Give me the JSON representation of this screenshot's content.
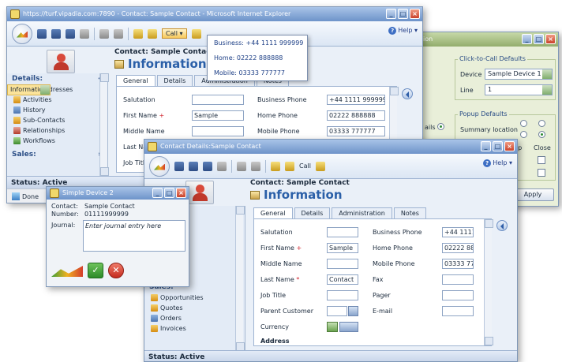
{
  "main_window": {
    "title": "https://turf.vipadia.com:7890 - Contact: Sample Contact - Microsoft Internet Explorer",
    "call_label": "Call",
    "help_label": "Help",
    "header_contact": "Contact: Sample Contact",
    "header_section": "Information",
    "tabs": [
      "General",
      "Details",
      "Administration",
      "Notes"
    ],
    "sidebar_title": "Details:",
    "sidebar_items": [
      "Information",
      "More Addresses",
      "Activities",
      "History",
      "Sub-Contacts",
      "Relationships",
      "Workflows"
    ],
    "sales_title": "Sales:",
    "status": "Status: Active",
    "ie_status": "Done",
    "form": {
      "salutation_label": "Salutation",
      "first_name_label": "First Name",
      "first_name_value": "Sample",
      "middle_name_label": "Middle Name",
      "last_name_label": "Last Na",
      "job_title_label": "Job Title",
      "business_phone_label": "Business Phone",
      "business_phone_value": "+44 1111 999999",
      "home_phone_label": "Home Phone",
      "home_phone_value": "02222 888888",
      "mobile_phone_label": "Mobile Phone",
      "mobile_phone_value": "03333 777777"
    }
  },
  "call_menu": {
    "items": [
      "Business: +44 1111 999999",
      "Home: 02222 888888",
      "Mobile: 03333 777777"
    ]
  },
  "options_window": {
    "title": "ion",
    "click_to_call_title": "Click-to-Call Defaults",
    "device_label": "Device",
    "device_value": "Sample Device 1",
    "line_label": "Line",
    "line_value": "1",
    "popup_title": "Popup Defaults",
    "summary_location_label": "Summary location",
    "partial_left": "ails",
    "popup_label_partial": "up",
    "close_label": "Close",
    "apply_label": "Apply"
  },
  "details_window": {
    "title": "Contact Details:Sample Contact",
    "call_label": "Call",
    "help_label": "Help",
    "header_contact": "Contact: Sample Contact",
    "header_section": "Information",
    "tabs": [
      "General",
      "Details",
      "Administration",
      "Notes"
    ],
    "sidebar_partial": [
      "n",
      "resses",
      "cts",
      "ips"
    ],
    "sales_title": "Sales:",
    "sales_items": [
      "Opportunities",
      "Quotes",
      "Orders",
      "Invoices"
    ],
    "status": "Status: Active",
    "form": {
      "salutation_label": "Salutation",
      "first_name_label": "First Name",
      "first_name_value": "Sample",
      "middle_name_label": "Middle Name",
      "last_name_label": "Last Name",
      "last_name_value": "Contact",
      "job_title_label": "Job Title",
      "parent_customer_label": "Parent Customer",
      "currency_label": "Currency",
      "address_label": "Address",
      "business_phone_label": "Business Phone",
      "business_phone_value": "+44 1111 9",
      "home_phone_label": "Home Phone",
      "home_phone_value": "02222 888",
      "mobile_phone_label": "Mobile Phone",
      "mobile_phone_value": "03333 777",
      "fax_label": "Fax",
      "pager_label": "Pager",
      "email_label": "E-mail"
    }
  },
  "device_window": {
    "title": "Simple Device 2",
    "contact_label": "Contact:",
    "contact_value": "Sample Contact",
    "number_label": "Number:",
    "number_value": "01111999999",
    "journal_label": "Journal:",
    "journal_placeholder": "Enter journal entry here"
  }
}
